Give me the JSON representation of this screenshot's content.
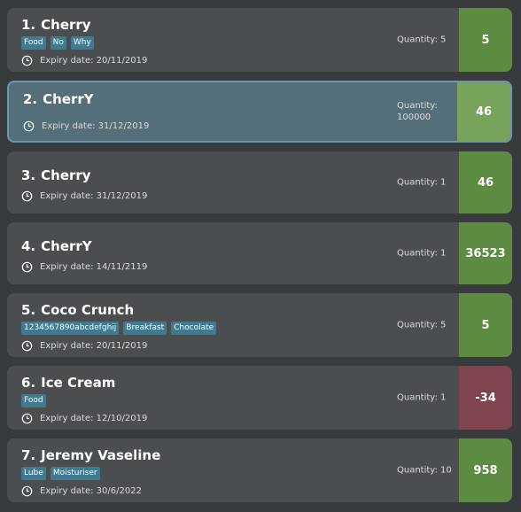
{
  "colors": {
    "background": "#383b3d",
    "card": "#4b4e51",
    "card_selected": "#546e7a",
    "tag": "#3e7b91",
    "days_ok": "#5e8b42",
    "days_ok_selected": "#77a45a",
    "days_expired": "#80444f"
  },
  "items": [
    {
      "index": "1.",
      "name": "Cherry",
      "tags": [
        "Food",
        "No",
        "Why"
      ],
      "expiry": "Expiry date: 20/11/2019",
      "quantity": "Quantity: 5",
      "days": "5",
      "status": "ok"
    },
    {
      "index": "2.",
      "name": "CherrY",
      "tags": [],
      "expiry": "Expiry date: 31/12/2019",
      "quantity": "Quantity: 100000",
      "days": "46",
      "status": "ok",
      "selected": true
    },
    {
      "index": "3.",
      "name": "Cherry",
      "tags": [],
      "expiry": "Expiry date: 31/12/2019",
      "quantity": "Quantity: 1",
      "days": "46",
      "status": "ok"
    },
    {
      "index": "4.",
      "name": "CherrY",
      "tags": [],
      "expiry": "Expiry date: 14/11/2119",
      "quantity": "Quantity: 1",
      "days": "36523",
      "status": "ok"
    },
    {
      "index": "5.",
      "name": "Coco Crunch",
      "tags": [
        "1234567890abcdefghij",
        "Breakfast",
        "Chocolate"
      ],
      "expiry": "Expiry date: 20/11/2019",
      "quantity": "Quantity: 5",
      "days": "5",
      "status": "ok"
    },
    {
      "index": "6.",
      "name": "Ice Cream",
      "tags": [
        "Food"
      ],
      "expiry": "Expiry date: 12/10/2019",
      "quantity": "Quantity: 1",
      "days": "-34",
      "status": "expired"
    },
    {
      "index": "7.",
      "name": "Jeremy Vaseline",
      "tags": [
        "Lube",
        "Moisturiser"
      ],
      "expiry": "Expiry date: 30/6/2022",
      "quantity": "Quantity: 10",
      "days": "958",
      "status": "ok"
    }
  ]
}
